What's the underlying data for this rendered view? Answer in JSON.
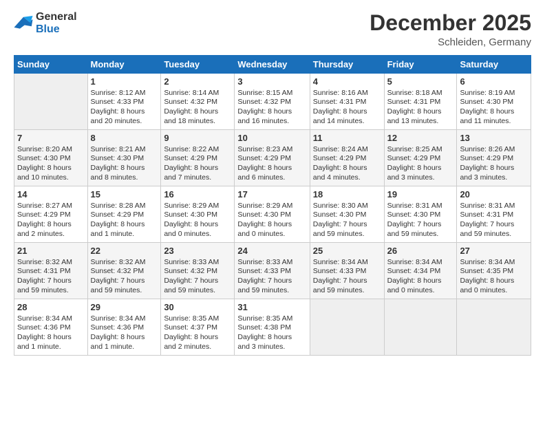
{
  "logo": {
    "line1": "General",
    "line2": "Blue"
  },
  "title": "December 2025",
  "subtitle": "Schleiden, Germany",
  "days_of_week": [
    "Sunday",
    "Monday",
    "Tuesday",
    "Wednesday",
    "Thursday",
    "Friday",
    "Saturday"
  ],
  "weeks": [
    [
      {
        "day": "",
        "info": ""
      },
      {
        "day": "1",
        "info": "Sunrise: 8:12 AM\nSunset: 4:33 PM\nDaylight: 8 hours\nand 20 minutes."
      },
      {
        "day": "2",
        "info": "Sunrise: 8:14 AM\nSunset: 4:32 PM\nDaylight: 8 hours\nand 18 minutes."
      },
      {
        "day": "3",
        "info": "Sunrise: 8:15 AM\nSunset: 4:32 PM\nDaylight: 8 hours\nand 16 minutes."
      },
      {
        "day": "4",
        "info": "Sunrise: 8:16 AM\nSunset: 4:31 PM\nDaylight: 8 hours\nand 14 minutes."
      },
      {
        "day": "5",
        "info": "Sunrise: 8:18 AM\nSunset: 4:31 PM\nDaylight: 8 hours\nand 13 minutes."
      },
      {
        "day": "6",
        "info": "Sunrise: 8:19 AM\nSunset: 4:30 PM\nDaylight: 8 hours\nand 11 minutes."
      }
    ],
    [
      {
        "day": "7",
        "info": "Sunrise: 8:20 AM\nSunset: 4:30 PM\nDaylight: 8 hours\nand 10 minutes."
      },
      {
        "day": "8",
        "info": "Sunrise: 8:21 AM\nSunset: 4:30 PM\nDaylight: 8 hours\nand 8 minutes."
      },
      {
        "day": "9",
        "info": "Sunrise: 8:22 AM\nSunset: 4:29 PM\nDaylight: 8 hours\nand 7 minutes."
      },
      {
        "day": "10",
        "info": "Sunrise: 8:23 AM\nSunset: 4:29 PM\nDaylight: 8 hours\nand 6 minutes."
      },
      {
        "day": "11",
        "info": "Sunrise: 8:24 AM\nSunset: 4:29 PM\nDaylight: 8 hours\nand 4 minutes."
      },
      {
        "day": "12",
        "info": "Sunrise: 8:25 AM\nSunset: 4:29 PM\nDaylight: 8 hours\nand 3 minutes."
      },
      {
        "day": "13",
        "info": "Sunrise: 8:26 AM\nSunset: 4:29 PM\nDaylight: 8 hours\nand 3 minutes."
      }
    ],
    [
      {
        "day": "14",
        "info": "Sunrise: 8:27 AM\nSunset: 4:29 PM\nDaylight: 8 hours\nand 2 minutes."
      },
      {
        "day": "15",
        "info": "Sunrise: 8:28 AM\nSunset: 4:29 PM\nDaylight: 8 hours\nand 1 minute."
      },
      {
        "day": "16",
        "info": "Sunrise: 8:29 AM\nSunset: 4:30 PM\nDaylight: 8 hours\nand 0 minutes."
      },
      {
        "day": "17",
        "info": "Sunrise: 8:29 AM\nSunset: 4:30 PM\nDaylight: 8 hours\nand 0 minutes."
      },
      {
        "day": "18",
        "info": "Sunrise: 8:30 AM\nSunset: 4:30 PM\nDaylight: 7 hours\nand 59 minutes."
      },
      {
        "day": "19",
        "info": "Sunrise: 8:31 AM\nSunset: 4:30 PM\nDaylight: 7 hours\nand 59 minutes."
      },
      {
        "day": "20",
        "info": "Sunrise: 8:31 AM\nSunset: 4:31 PM\nDaylight: 7 hours\nand 59 minutes."
      }
    ],
    [
      {
        "day": "21",
        "info": "Sunrise: 8:32 AM\nSunset: 4:31 PM\nDaylight: 7 hours\nand 59 minutes."
      },
      {
        "day": "22",
        "info": "Sunrise: 8:32 AM\nSunset: 4:32 PM\nDaylight: 7 hours\nand 59 minutes."
      },
      {
        "day": "23",
        "info": "Sunrise: 8:33 AM\nSunset: 4:32 PM\nDaylight: 7 hours\nand 59 minutes."
      },
      {
        "day": "24",
        "info": "Sunrise: 8:33 AM\nSunset: 4:33 PM\nDaylight: 7 hours\nand 59 minutes."
      },
      {
        "day": "25",
        "info": "Sunrise: 8:34 AM\nSunset: 4:33 PM\nDaylight: 7 hours\nand 59 minutes."
      },
      {
        "day": "26",
        "info": "Sunrise: 8:34 AM\nSunset: 4:34 PM\nDaylight: 8 hours\nand 0 minutes."
      },
      {
        "day": "27",
        "info": "Sunrise: 8:34 AM\nSunset: 4:35 PM\nDaylight: 8 hours\nand 0 minutes."
      }
    ],
    [
      {
        "day": "28",
        "info": "Sunrise: 8:34 AM\nSunset: 4:36 PM\nDaylight: 8 hours\nand 1 minute."
      },
      {
        "day": "29",
        "info": "Sunrise: 8:34 AM\nSunset: 4:36 PM\nDaylight: 8 hours\nand 1 minute."
      },
      {
        "day": "30",
        "info": "Sunrise: 8:35 AM\nSunset: 4:37 PM\nDaylight: 8 hours\nand 2 minutes."
      },
      {
        "day": "31",
        "info": "Sunrise: 8:35 AM\nSunset: 4:38 PM\nDaylight: 8 hours\nand 3 minutes."
      },
      {
        "day": "",
        "info": ""
      },
      {
        "day": "",
        "info": ""
      },
      {
        "day": "",
        "info": ""
      }
    ]
  ]
}
